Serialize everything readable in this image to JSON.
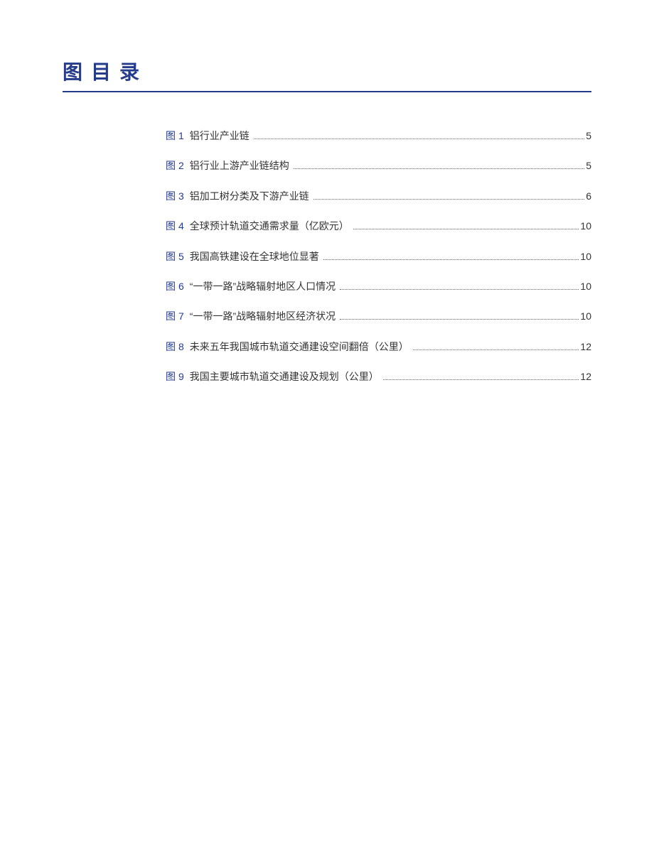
{
  "title": "图目录",
  "label_prefix": "图",
  "entries": [
    {
      "num": "1",
      "title": "铝行业产业链",
      "page": "5"
    },
    {
      "num": "2",
      "title": "铝行业上游产业链结构",
      "page": "5"
    },
    {
      "num": "3",
      "title": "铝加工树分类及下游产业链",
      "page": "6"
    },
    {
      "num": "4",
      "title": "全球预计轨道交通需求量（亿欧元）",
      "page": "10"
    },
    {
      "num": "5",
      "title": "我国高铁建设在全球地位显著",
      "page": "10"
    },
    {
      "num": "6",
      "title": "“一带一路”战略辐射地区人口情况",
      "page": "10"
    },
    {
      "num": "7",
      "title": "“一带一路”战略辐射地区经济状况",
      "page": "10"
    },
    {
      "num": "8",
      "title": "未来五年我国城市轨道交通建设空间翻倍（公里）",
      "page": "12"
    },
    {
      "num": "9",
      "title": "我国主要城市轨道交通建设及规划（公里）",
      "page": "12"
    }
  ]
}
